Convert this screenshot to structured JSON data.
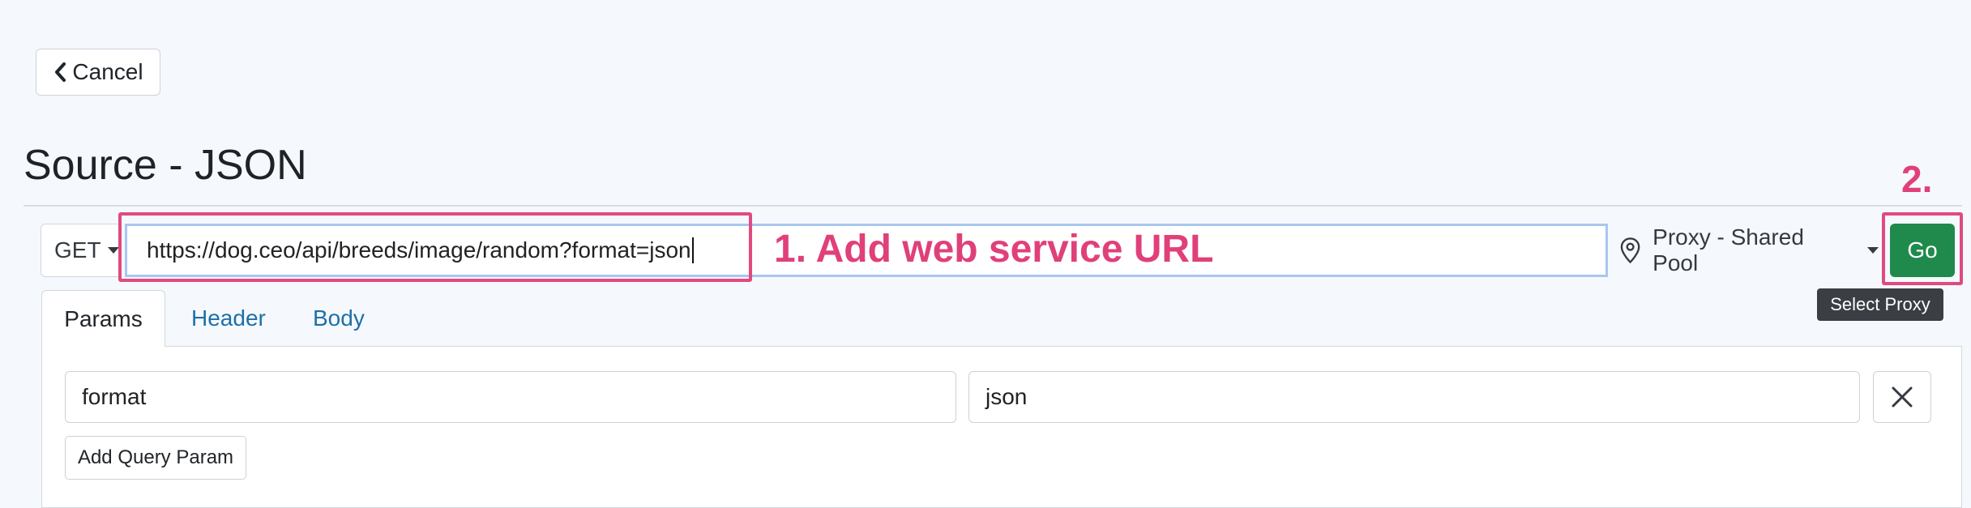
{
  "header": {
    "cancel_label": "Cancel",
    "cancel_icon": "chevron-left-icon",
    "title": "Source - JSON"
  },
  "request": {
    "method": "GET",
    "url": "https://dog.ceo/api/breeds/image/random?format=json",
    "proxy_icon": "map-pin-icon",
    "proxy_label": "Proxy - Shared Pool",
    "go_label": "Go",
    "tooltip": "Select Proxy"
  },
  "annotations": {
    "step1": "1. Add web service URL",
    "step2": "2.",
    "color": "#e0407a"
  },
  "tabs": [
    {
      "label": "Params",
      "active": true
    },
    {
      "label": "Header",
      "active": false
    },
    {
      "label": "Body",
      "active": false
    }
  ],
  "params": {
    "rows": [
      {
        "key": "format",
        "value": "json"
      }
    ],
    "remove_icon": "close-icon",
    "add_label": "Add Query Param"
  },
  "colors": {
    "go_button": "#1f8a4c",
    "link": "#1f6fa8",
    "url_focus_border": "#a8c7f0",
    "background": "#f5f9fd"
  }
}
